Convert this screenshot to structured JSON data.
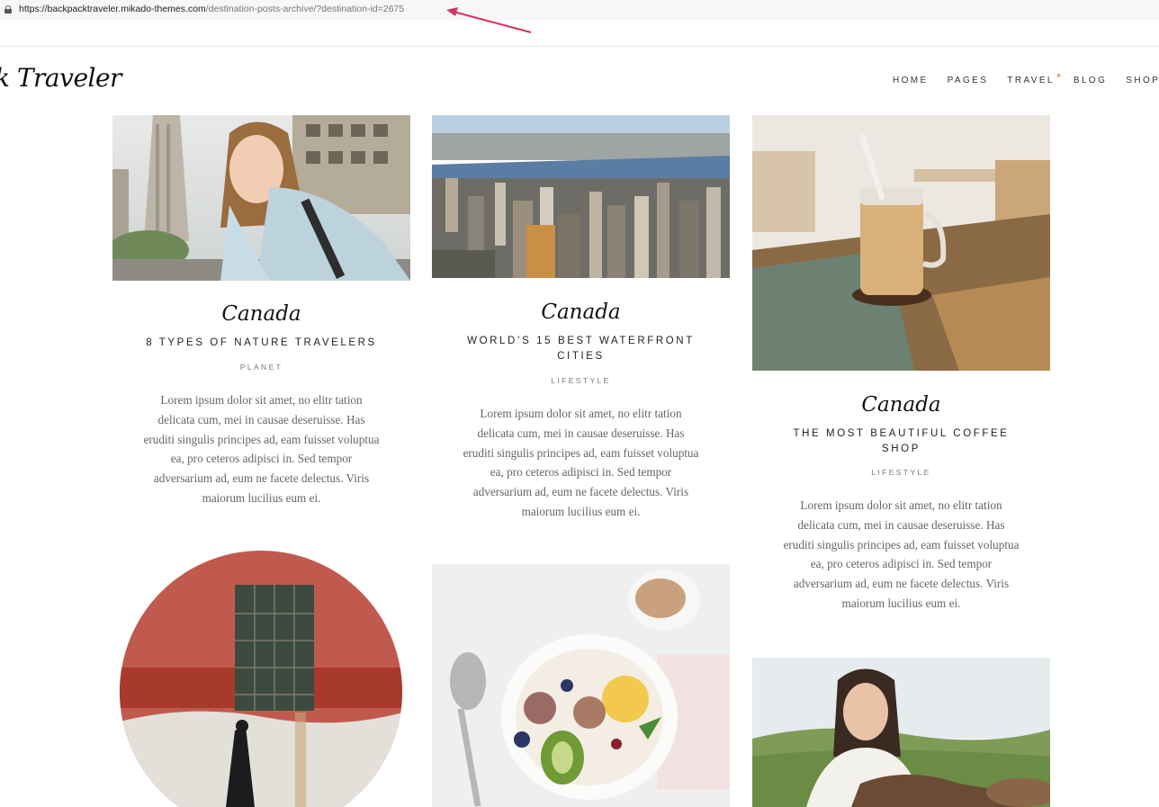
{
  "browser": {
    "url_host": "https://backpacktraveler.mikado-themes.com",
    "url_path": "/destination-posts-archive/?destination-id=2675",
    "annotation_color": "#d8325f"
  },
  "header": {
    "logo_text": "k Traveler",
    "nav": [
      "HOME",
      "PAGES",
      "TRAVEL",
      "BLOG",
      "SHOP"
    ],
    "travel_marker": "*",
    "accent_color": "#e8643a"
  },
  "posts": [
    {
      "destination": "Canada",
      "title": "8 TYPES OF NATURE TRAVELERS",
      "category": "PLANET",
      "excerpt": "Lorem ipsum dolor sit amet, no elitr tation delicata cum, mei in causae deseruisse. Has eruditi singulis principes ad, eam fuisset voluptua ea, pro ceteros adipisci in. Sed tempor adversarium ad, eum ne facete delectus. Viris maiorum lucilius eum ei.",
      "image": "woman-selfie-city-photo"
    },
    {
      "destination": "Canada",
      "title": "WORLD’S 15 BEST WATERFRONT CITIES",
      "category": "LIFESTYLE",
      "excerpt": "Lorem ipsum dolor sit amet, no elitr tation delicata cum, mei in causae deseruisse. Has eruditi singulis principes ad, eam fuisset voluptua ea, pro ceteros adipisci in. Sed tempor adversarium ad, eum ne facete delectus. Viris maiorum lucilius eum ei.",
      "image": "city-skyline-photo"
    },
    {
      "destination": "Canada",
      "title": "THE MOST BEAUTIFUL COFFEE SHOP",
      "category": "LIFESTYLE",
      "excerpt": "Lorem ipsum dolor sit amet, no elitr tation delicata cum, mei in causae deseruisse. Has eruditi singulis principes ad, eam fuisset voluptua ea, pro ceteros adipisci in. Sed tempor adversarium ad, eum ne facete delectus. Viris maiorum lucilius eum ei.",
      "image": "iced-coffee-jar-photo"
    }
  ],
  "more_images": [
    "red-wall-window-circle-photo",
    "fruit-bowl-breakfast-photo",
    "smiling-woman-field-photo"
  ]
}
